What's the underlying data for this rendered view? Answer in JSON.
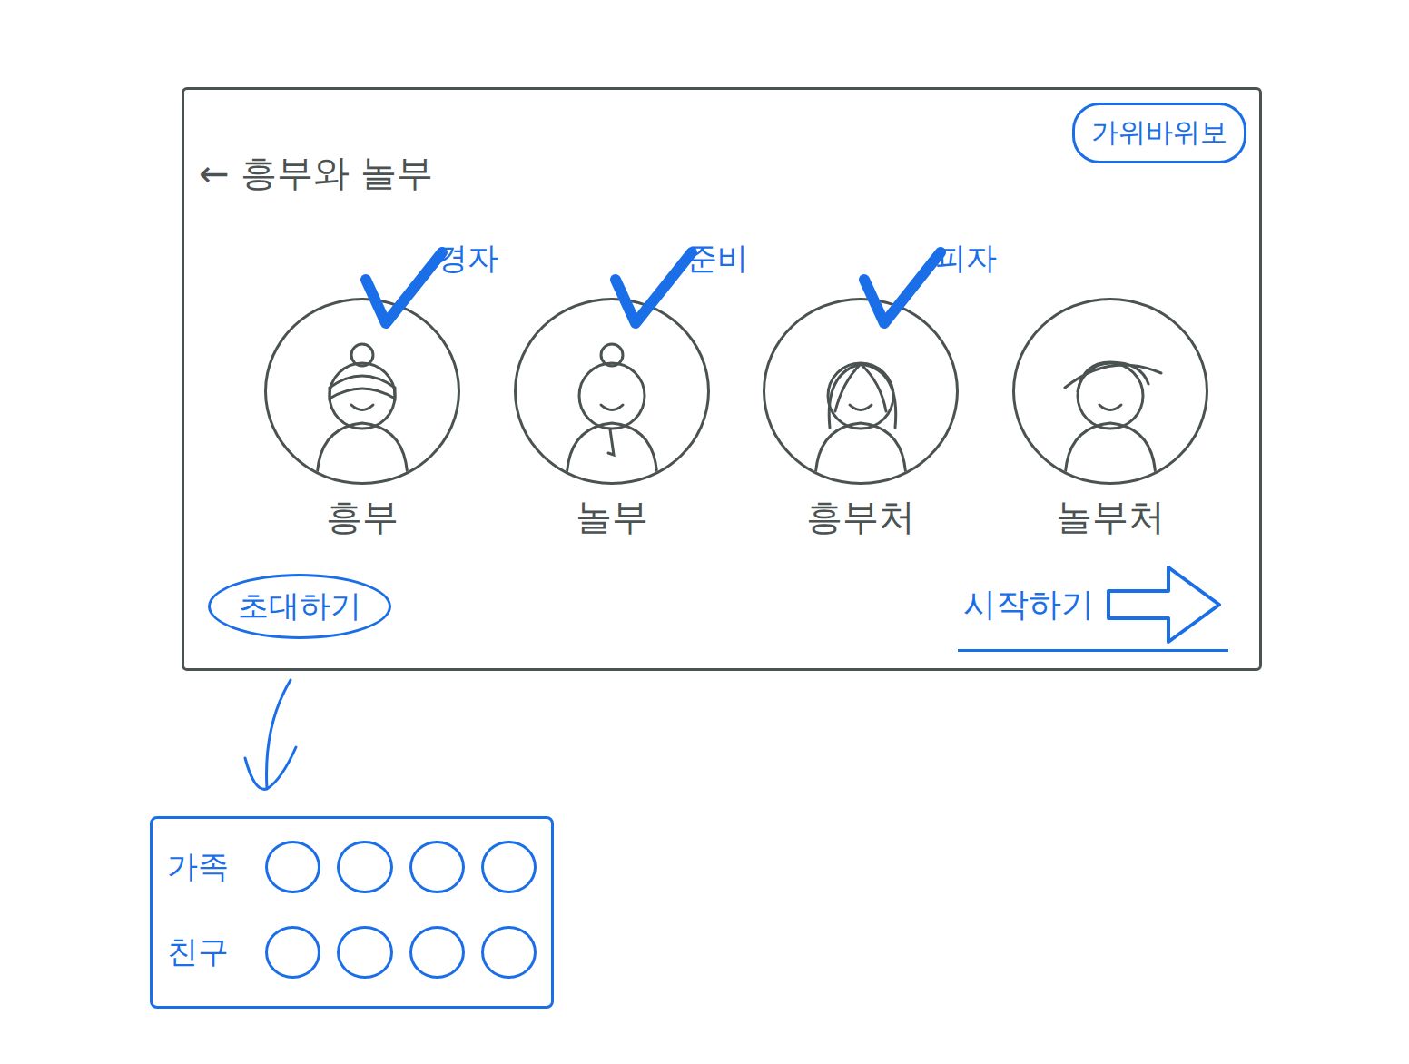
{
  "screen": {
    "back": "←",
    "title": "흥부와 놀부",
    "mode_button": "가위바위보"
  },
  "characters": [
    {
      "name": "흥부",
      "kind": "hat",
      "checked": true,
      "player": "경자"
    },
    {
      "name": "놀부",
      "kind": "topknot",
      "checked": true,
      "player": "준비"
    },
    {
      "name": "흥부처",
      "kind": "long-hair",
      "checked": true,
      "player": "피자"
    },
    {
      "name": "놀부처",
      "kind": "bun",
      "checked": false
    }
  ],
  "invite_button": "초대하기",
  "start_button": "시작하기",
  "invite_panel": {
    "groups": [
      {
        "label": "가족",
        "slots": 4
      },
      {
        "label": "친구",
        "slots": 4
      }
    ]
  }
}
